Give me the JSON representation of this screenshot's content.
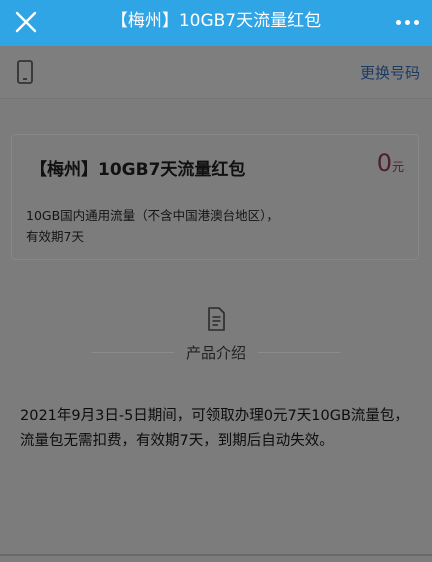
{
  "header": {
    "title": "【梅州】10GB7天流量红包",
    "close_icon": "close-icon",
    "more_icon": "more-dots-icon",
    "accent_color": "#2fa5e6"
  },
  "phone_bar": {
    "icon": "phone-icon",
    "change_label": "更换号码"
  },
  "product": {
    "title": "【梅州】10GB7天流量红包",
    "price": "0",
    "price_unit": "元",
    "desc_line1": "10GB国内通用流量（不含中国港澳台地区），",
    "desc_line2": "有效期7天"
  },
  "section": {
    "icon": "document-icon",
    "title": "产品介绍"
  },
  "intro": {
    "text": "2021年9月3日-5日期间，可领取办理0元7天10GB流量包，流量包无需扣费，有效期7天，到期后自动失效。"
  }
}
